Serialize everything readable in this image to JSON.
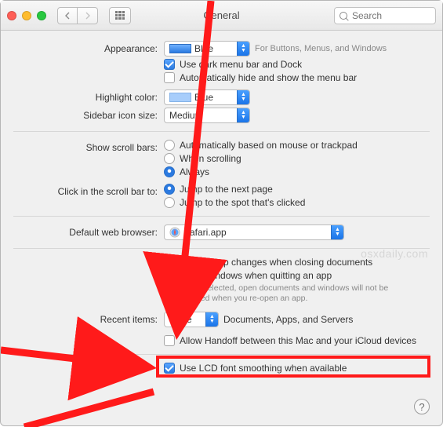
{
  "titlebar": {
    "title": "General",
    "search_placeholder": "Search"
  },
  "appearance": {
    "label": "Appearance:",
    "value": "Blue",
    "hint": "For Buttons, Menus, and Windows",
    "darkmenu_label": "Use dark menu bar and Dock",
    "darkmenu_checked": true,
    "autohide_label": "Automatically hide and show the menu bar",
    "autohide_checked": false
  },
  "highlight": {
    "label": "Highlight color:",
    "value": "Blue"
  },
  "sidebar": {
    "label": "Sidebar icon size:",
    "value": "Medium"
  },
  "scrollbars": {
    "label": "Show scroll bars:",
    "opt_auto": "Automatically based on mouse or trackpad",
    "opt_when": "When scrolling",
    "opt_always": "Always",
    "selected": "always"
  },
  "clickbar": {
    "label": "Click in the scroll bar to:",
    "opt_next": "Jump to the next page",
    "opt_spot": "Jump to the spot that's clicked",
    "selected": "next"
  },
  "browser": {
    "label": "Default web browser:",
    "value": "Safari.app"
  },
  "documents": {
    "ask_label": "Ask to keep changes when closing documents",
    "ask_checked": false,
    "close_label": "Close windows when quitting an app",
    "close_checked": false,
    "note": "When selected, open documents and windows will not be restored when you re-open an app."
  },
  "recent": {
    "label": "Recent items:",
    "value": "None",
    "suffix": "Documents, Apps, and Servers"
  },
  "handoff": {
    "label": "Allow Handoff between this Mac and your iCloud devices",
    "checked": false
  },
  "lcd": {
    "label": "Use LCD font smoothing when available",
    "checked": true
  },
  "watermark": "osxdaily.com"
}
